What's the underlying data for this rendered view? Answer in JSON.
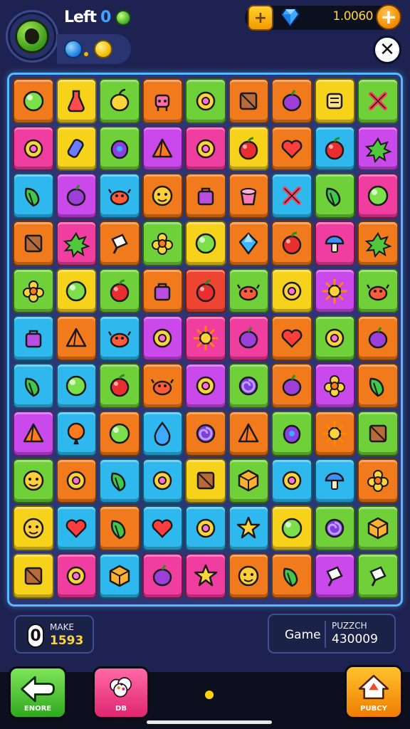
{
  "header": {
    "title": "Left",
    "title_glyph": "0",
    "currency_amount": "1.0060",
    "coin_symbol": "+",
    "plus_symbol": "+",
    "close_symbol": "✕",
    "avatar_icon": "green-orb-icon",
    "orbs": [
      "blue-orb-icon",
      "yellow-orb-icon"
    ]
  },
  "colors": {
    "background": "#1d2250",
    "board_border": "#57b8ff",
    "gold": "#ffd43b"
  },
  "tile_palette": {
    "o": "#f07a1c",
    "y": "#f7d21b",
    "g": "#6fd03a",
    "c": "#2fb8ee",
    "p": "#c949ea",
    "m": "#f03da0",
    "r": "#ee4432"
  },
  "board": {
    "rows": 11,
    "cols": 9,
    "tiles": [
      [
        "o",
        "y",
        "g",
        "o",
        "g",
        "o",
        "o",
        "y",
        "g"
      ],
      [
        "m",
        "y",
        "g",
        "p",
        "m",
        "y",
        "o",
        "c",
        "p"
      ],
      [
        "c",
        "p",
        "c",
        "o",
        "o",
        "o",
        "c",
        "g",
        "m"
      ],
      [
        "o",
        "m",
        "o",
        "g",
        "y",
        "o",
        "o",
        "m",
        "o"
      ],
      [
        "g",
        "y",
        "g",
        "o",
        "r",
        "g",
        "y",
        "p",
        "g"
      ],
      [
        "c",
        "o",
        "c",
        "p",
        "m",
        "m",
        "o",
        "g",
        "o"
      ],
      [
        "c",
        "c",
        "g",
        "o",
        "p",
        "g",
        "o",
        "p",
        "o"
      ],
      [
        "p",
        "c",
        "o",
        "c",
        "o",
        "o",
        "g",
        "o",
        "g"
      ],
      [
        "g",
        "o",
        "c",
        "c",
        "y",
        "g",
        "c",
        "c",
        "o"
      ],
      [
        "y",
        "c",
        "o",
        "c",
        "c",
        "c",
        "y",
        "g",
        "g"
      ],
      [
        "y",
        "m",
        "c",
        "m",
        "m",
        "o",
        "o",
        "p",
        "g"
      ]
    ],
    "icons": [
      [
        "ball",
        "potion",
        "fruit",
        "robot",
        "ring",
        "box",
        "plum",
        "scroll",
        "cross"
      ],
      [
        "ring",
        "bottle",
        "bug",
        "pyramid",
        "ring",
        "apple",
        "heart",
        "apple",
        "splat"
      ],
      [
        "leaf",
        "plum",
        "crab",
        "face",
        "bag",
        "cup",
        "cross",
        "leaf",
        "ball"
      ],
      [
        "box",
        "splat",
        "ice",
        "flower",
        "ball",
        "gem",
        "apple",
        "mushroom",
        "splat"
      ],
      [
        "flower",
        "ball",
        "apple",
        "bag",
        "apple",
        "crab",
        "ring",
        "sun",
        "crab"
      ],
      [
        "bag",
        "pyramid",
        "crab",
        "ring",
        "sun",
        "plum",
        "heart",
        "ring",
        "plum"
      ],
      [
        "leaf",
        "ball",
        "apple",
        "crab",
        "ring",
        "swirl",
        "plum",
        "flower",
        "leaf"
      ],
      [
        "pyramid",
        "balloon",
        "ball",
        "drop",
        "swirl",
        "pyramid",
        "bug",
        "sun",
        "box"
      ],
      [
        "face",
        "ring",
        "leaf",
        "ring",
        "box",
        "cube",
        "ring",
        "mushroom",
        "flower"
      ],
      [
        "face",
        "heart",
        "leaf",
        "heart",
        "ring",
        "star",
        "ball",
        "swirl",
        "cube"
      ],
      [
        "box",
        "ring",
        "cube",
        "plum",
        "star",
        "face",
        "leaf",
        "ice",
        "ice"
      ]
    ]
  },
  "panels": {
    "left": {
      "badge": "0",
      "label": "MAKE",
      "value": "1593"
    },
    "right": {
      "label": "Game",
      "top_label": "PUZZCH",
      "value": "430009"
    }
  },
  "nav": {
    "green_label": "ENORE",
    "pink_label": "DB",
    "orange_label": "PUBCY",
    "green_icon": "arrow-left-icon",
    "pink_icon": "cupcake-icon",
    "orange_icon": "house-icon"
  }
}
